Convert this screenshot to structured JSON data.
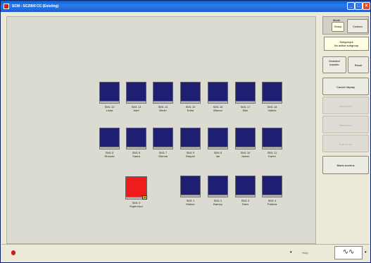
{
  "window": {
    "title": "SCM - SC2000 CC (Existing)"
  },
  "monitors": [
    {
      "label": "SM1 12\nLinda"
    },
    {
      "label": "SM1 13\nAdel"
    },
    {
      "label": "SM1 14\nBerlin"
    },
    {
      "label": "SM1 15\nEdfra"
    },
    {
      "label": "SM1 16\nBlanca"
    },
    {
      "label": "SM1 17\nEllie"
    },
    {
      "label": "SM1 18\nValerie"
    },
    {
      "label": "SM1 5\nRhonda"
    },
    {
      "label": "SM1 6\nSaara"
    },
    {
      "label": "SM1 7\nGlenda"
    },
    {
      "label": "SM1 9\nRaquel"
    },
    {
      "label": "SM1 8\nIan"
    },
    {
      "label": "SM1 10\nJames"
    },
    {
      "label": "SM1 11\nKaren"
    },
    {
      "label": "SM1 1\nMarion"
    },
    {
      "label": "SM1 2\nBarney"
    },
    {
      "label": "SM1 3\nDrew"
    },
    {
      "label": "SM1 4\nPatricia"
    }
  ],
  "supervisor": {
    "label": "SM1 0\nSupervisor",
    "badge": "M"
  },
  "side": {
    "mode_label": "Mode",
    "group_btn": "Group",
    "custom_btn": "Custom",
    "subgroup_title": "Subgroups",
    "subgroup_value": "No active subgroup",
    "deselect_btn": "Deselect\ntransfer",
    "reset_btn": "Reset",
    "cancel_btn": "Cancel display",
    "disabled1": "Interactive",
    "disabled2": "Interactive",
    "disabled3": "Follow me",
    "blank_btn": "Blank screens"
  },
  "status": {
    "help": "Help"
  }
}
